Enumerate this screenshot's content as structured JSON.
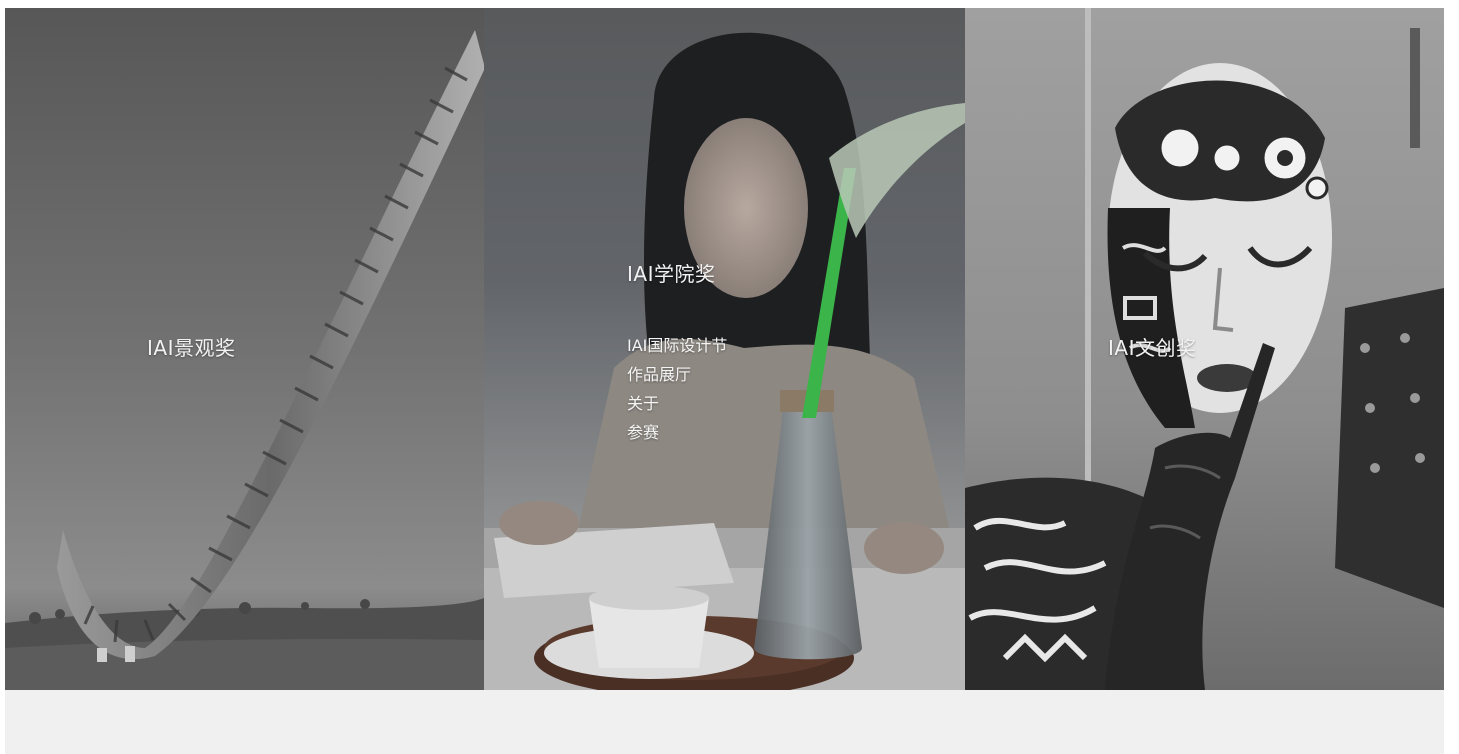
{
  "panels": [
    {
      "id": "landscape",
      "title": "IAI景观奖",
      "image": "landscape-sculpture"
    },
    {
      "id": "academy",
      "title": "IAI学院奖",
      "image": "woman-with-vase",
      "submenu": [
        "IAI国际设计节",
        "作品展厅",
        "关于",
        "参赛"
      ]
    },
    {
      "id": "creative",
      "title": "IAI文创奖",
      "image": "painted-mask"
    }
  ],
  "colors": {
    "title_text": "#f2f2f2",
    "footer_band": "#f0f0f0",
    "vase_stem": "#3bb54a"
  }
}
